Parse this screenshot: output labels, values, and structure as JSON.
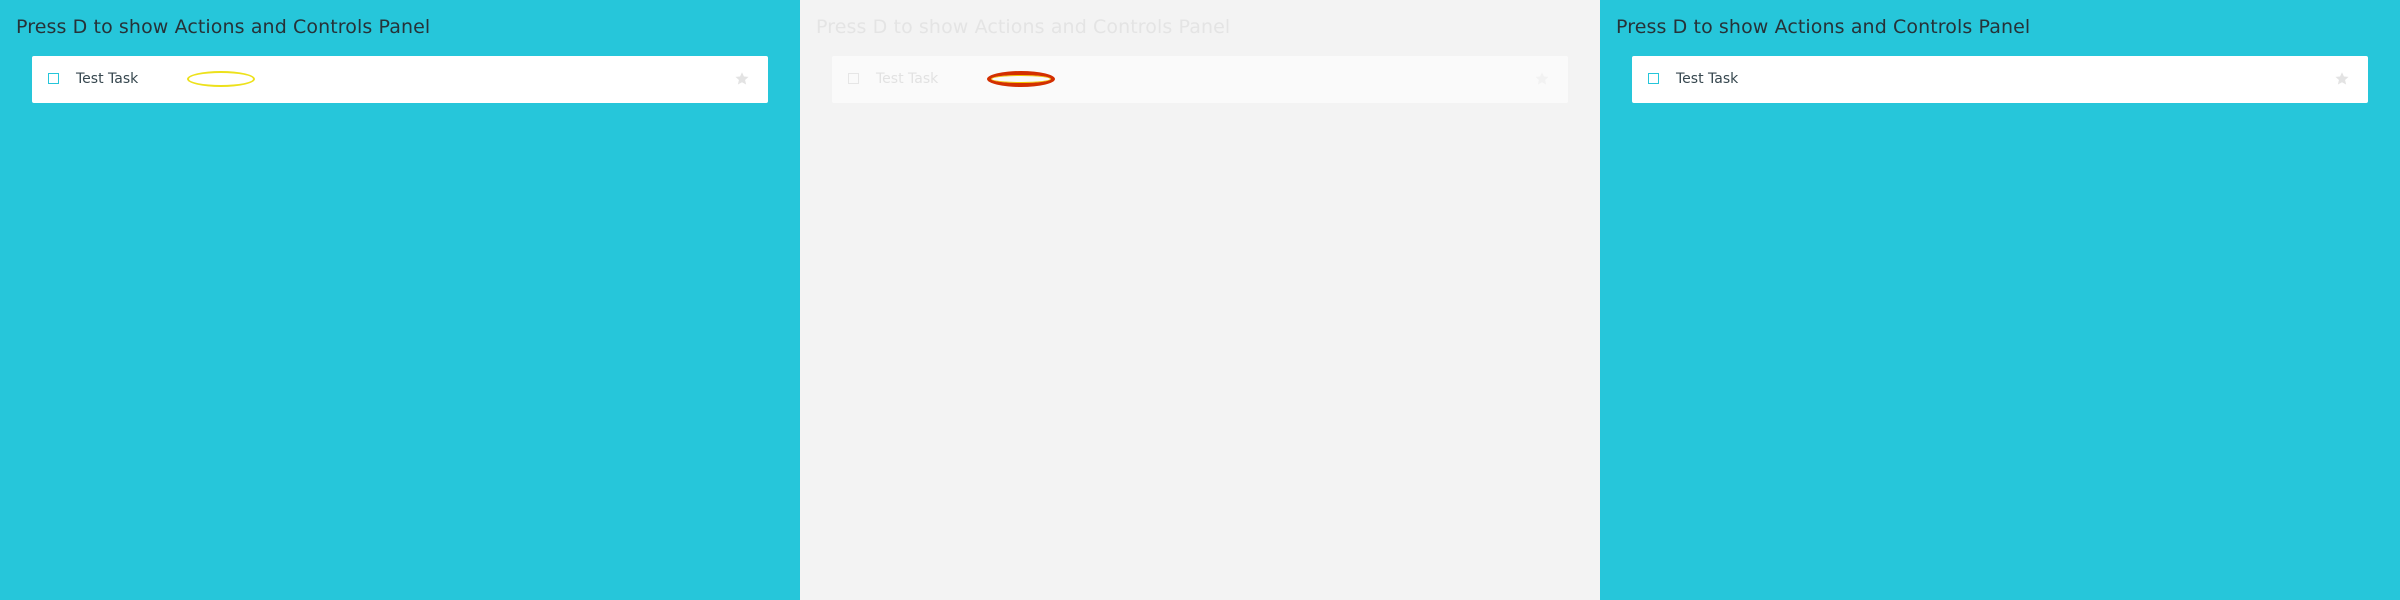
{
  "panels": [
    {
      "id": "left",
      "hint": "Press D to show Actions and Controls Panel",
      "task": {
        "title": "Test Task"
      },
      "highlight": "yellow-outline",
      "colors": {
        "background": "#26c6da",
        "row": "#ffffff",
        "checkbox": "#26c6da",
        "highlight": "#ede11b"
      },
      "icons": {
        "checkbox": "checkbox-icon",
        "pin": "star-icon"
      }
    },
    {
      "id": "middle",
      "hint": "Press D to show Actions and Controls Panel",
      "task": {
        "title": "Test Task"
      },
      "highlight": "red-outline",
      "colors": {
        "background": "#f3f3f3",
        "row": "#fafafa",
        "checkbox": "#e6e6e6",
        "highlight": "#d32f00"
      },
      "icons": {
        "checkbox": "checkbox-icon",
        "pin": "star-icon"
      }
    },
    {
      "id": "right",
      "hint": "Press D to show Actions and Controls Panel",
      "task": {
        "title": "Test Task"
      },
      "highlight": "none",
      "colors": {
        "background": "#26c6da",
        "row": "#ffffff",
        "checkbox": "#26c6da"
      },
      "icons": {
        "checkbox": "checkbox-icon",
        "pin": "star-icon"
      }
    }
  ]
}
